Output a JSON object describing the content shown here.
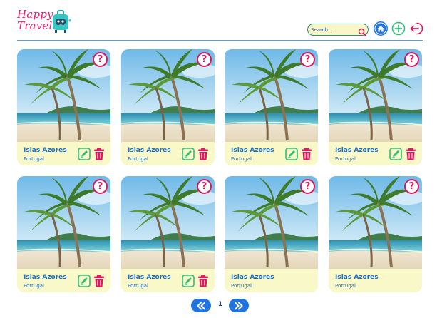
{
  "app": {
    "logo_line1": "Happy",
    "logo_line2": "Travel"
  },
  "search": {
    "placeholder": "Search..."
  },
  "colors": {
    "brand_pink": "#e91e72",
    "accent_blue": "#1f74e2",
    "accent_green": "#2fbf76",
    "danger_red": "#e0195a",
    "card_bg": "#f8f8c8"
  },
  "icons": {
    "search": "search-icon",
    "home": "home-icon",
    "add": "plus-circle-icon",
    "logout": "logout-icon",
    "help": "question-icon",
    "edit": "edit-icon",
    "delete": "trash-icon",
    "prev": "double-chevron-left-icon",
    "next": "double-chevron-right-icon"
  },
  "cards": [
    {
      "name": "Islas Azores",
      "country": "Portugal",
      "help": "?",
      "editable": true
    },
    {
      "name": "Islas Azores",
      "country": "Portugal",
      "help": "?",
      "editable": true
    },
    {
      "name": "Islas Azores",
      "country": "Portugal",
      "help": "?",
      "editable": true
    },
    {
      "name": "Islas Azores",
      "country": "Portugal",
      "help": "?",
      "editable": true
    },
    {
      "name": "Islas Azores",
      "country": "Portugal",
      "help": "?",
      "editable": true
    },
    {
      "name": "Islas Azores",
      "country": "Portugal",
      "help": "?",
      "editable": true
    },
    {
      "name": "Islas Azores",
      "country": "Portugal",
      "help": "?",
      "editable": false
    },
    {
      "name": "Islas Azores",
      "country": "Portugal",
      "help": "?",
      "editable": false
    }
  ],
  "pagination": {
    "current_page": "1"
  }
}
